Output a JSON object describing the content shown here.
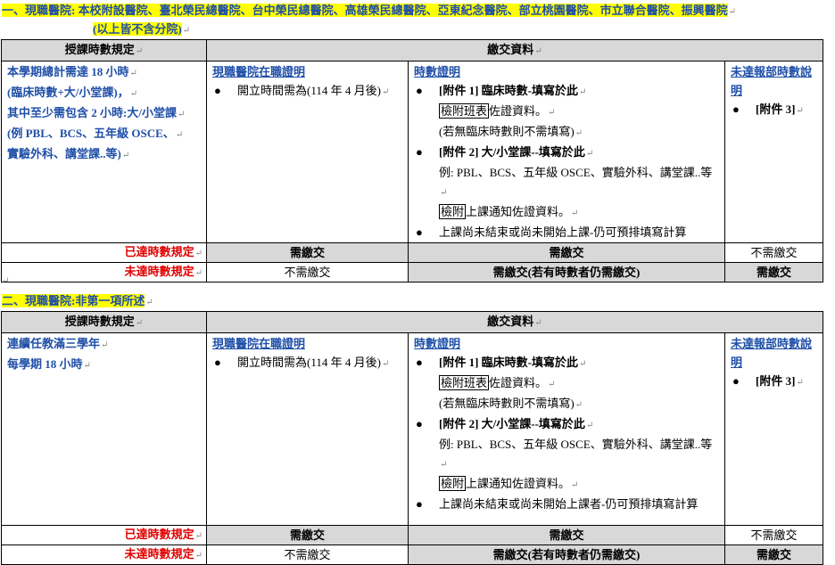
{
  "mark": "↵",
  "section1": {
    "title_line1": "一、現職醫院: 本校附設醫院、臺北榮民總醫院、台中榮民總醫院、高雄榮民總醫院、亞東紀念醫院、部立桃園醫院、市立聯合醫院、振興醫院",
    "title_line2": "(以上皆不含分院)",
    "header_left": "授課時數規定",
    "header_right": "繳交資料",
    "left_l1": "本學期總計需達 18 小時",
    "left_l2": "(臨床時數+大/小堂課)，",
    "left_l3": "其中至少需包含 2 小時:大/小堂課",
    "left_l4": "(例 PBL、BCS、五年級 OSCE、",
    "left_l5": "實驗外科、講堂課..等)",
    "cert_title": "現職醫院在職證明",
    "cert_item": "開立時間需為(114 年 4 月後)",
    "hours_title": "時數證明",
    "att1_title": "[附件 1]  臨床時數-填寫於此",
    "att1_box": "檢附班表",
    "att1_rest": "佐證資料。",
    "att1_note": "(若無臨床時數則不需填寫)",
    "att2_title": "[附件 2]  大/小堂課--填寫於此",
    "att2_ex": "例: PBL、BCS、五年級 OSCE、實驗外科、講堂課..等",
    "att2_box": "檢附",
    "att2_rest": "上課通知佐證資料。",
    "att2_last": "上課尚未結束或尚未開始上課-仍可預排填寫計算",
    "unrep_title": "未達報部時數說明",
    "att3": "[附件 3]",
    "row_met": "已達時數規定",
    "row_unmet": "未達時數規定",
    "need": "需繳交",
    "noneed": "不需繳交",
    "need_if": "需繳交(若有時數者仍需繳交)"
  },
  "section2": {
    "title": "二、現職醫院:非第一項所述",
    "header_left": "授課時數規定",
    "header_right": "繳交資料",
    "left_l1": "連續任教滿三學年",
    "left_l2": "每學期 18 小時",
    "cert_title": "現職醫院在職證明",
    "cert_item": "開立時間需為(114 年 4 月後)",
    "hours_title": "時數證明",
    "att1_title": "[附件 1]  臨床時數-填寫於此",
    "att1_box": "檢附班表",
    "att1_rest": "佐證資料。",
    "att1_note": "(若無臨床時數則不需填寫)",
    "att2_title": "[附件 2]  大/小堂課--填寫於此",
    "att2_ex": "例: PBL、BCS、五年級 OSCE、實驗外科、講堂課..等",
    "att2_box": "檢附",
    "att2_rest": "上課通知佐證資料。",
    "att2_last": "上課尚未結束或尚未開始上課者-仍可預排填寫計算",
    "unrep_title": "未達報部時數說明",
    "att3": "[附件 3]",
    "row_met": "已達時數規定",
    "row_unmet": "未達時數規定",
    "need": "需繳交",
    "noneed": "不需繳交",
    "need_if": "需繳交(若有時數者仍需繳交)"
  }
}
